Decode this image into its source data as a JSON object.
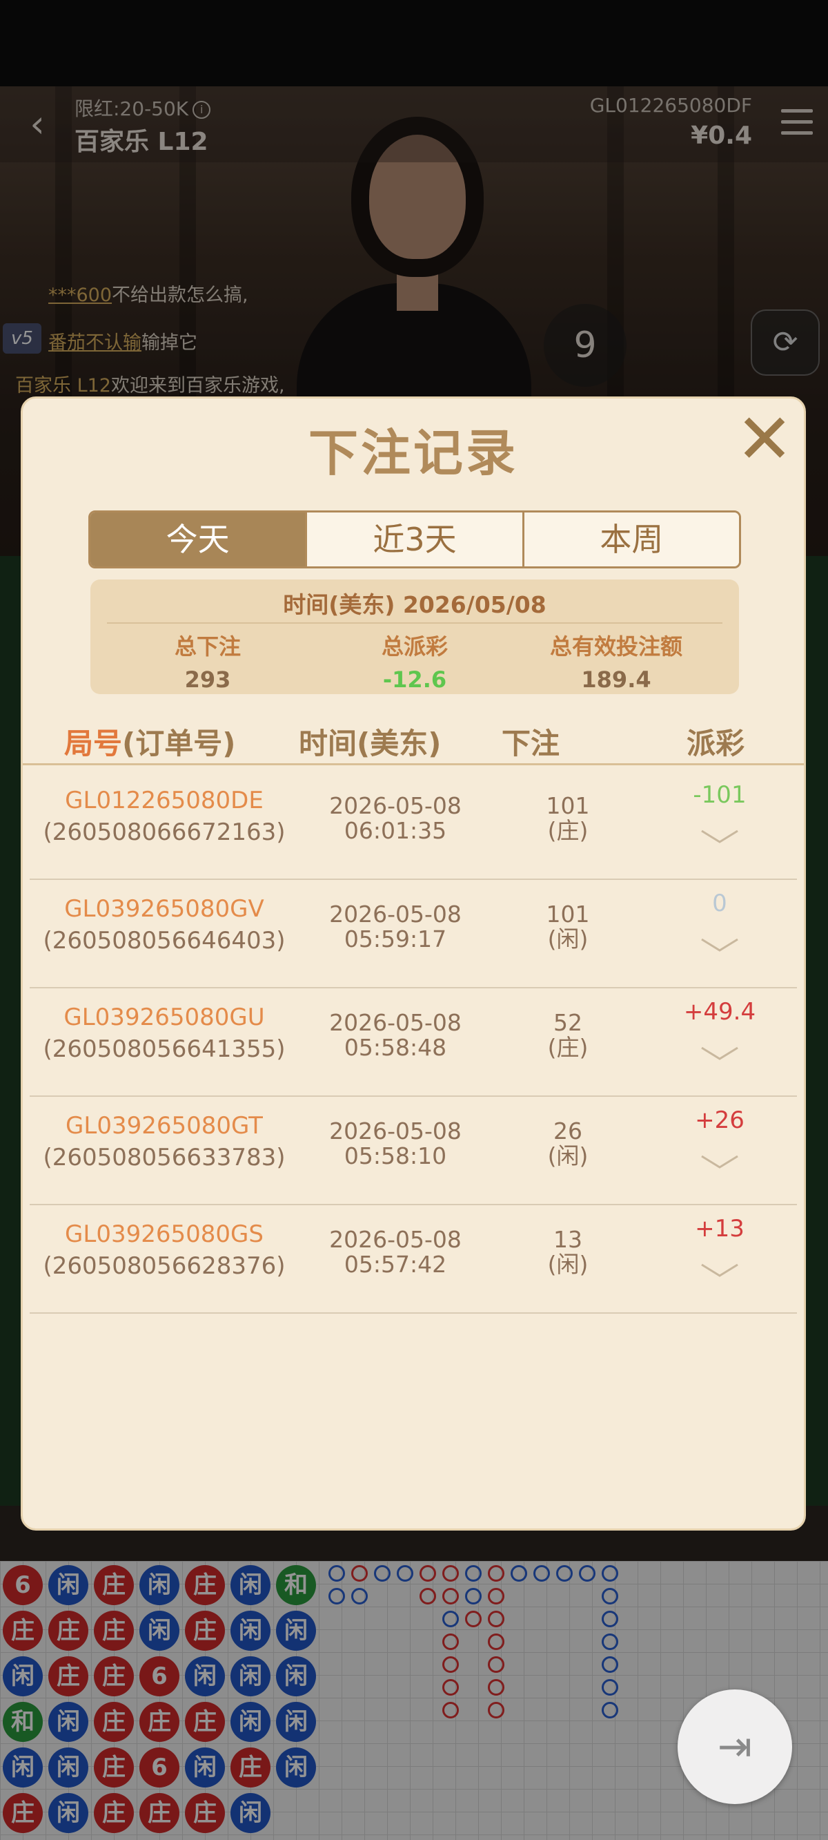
{
  "header": {
    "limit_label": "限红:20-50K",
    "table_name": "百家乐 L12",
    "account_id": "GL012265080DF",
    "balance": "¥0.4"
  },
  "chat": [
    {
      "user": "***600",
      "text": "不给出款怎么搞,"
    },
    {
      "user": "番茄不认输",
      "text": "输掉它"
    },
    {
      "user": "百家乐 L12",
      "text": "欢迎来到百家乐游戏,"
    }
  ],
  "round_number": "9",
  "modal": {
    "title": "下注记录",
    "tabs": [
      {
        "label": "今天",
        "active": true
      },
      {
        "label": "近3天",
        "active": false
      },
      {
        "label": "本周",
        "active": false
      }
    ],
    "summary": {
      "date_line": "时间(美东) 2026/05/08",
      "total_bet_label": "总下注",
      "total_bet": "293",
      "total_payout_label": "总派彩",
      "total_payout": "-12.6",
      "total_valid_label": "总有效投注额",
      "total_valid": "189.4"
    },
    "columns": {
      "round_highlight": "局号",
      "round_rest": "(订单号)",
      "time": "时间(美东)",
      "bet": "下注",
      "payout": "派彩"
    },
    "rows": [
      {
        "round": "GL012265080DE",
        "order": "(260508066672163)",
        "date": "2026-05-08",
        "time": "06:01:35",
        "bet": "101",
        "side": "(庄)",
        "payout": "-101",
        "tone": "neg"
      },
      {
        "round": "GL039265080GV",
        "order": "(260508056646403)",
        "date": "2026-05-08",
        "time": "05:59:17",
        "bet": "101",
        "side": "(闲)",
        "payout": "0",
        "tone": "zero"
      },
      {
        "round": "GL039265080GU",
        "order": "(260508056641355)",
        "date": "2026-05-08",
        "time": "05:58:48",
        "bet": "52",
        "side": "(庄)",
        "payout": "+49.4",
        "tone": "pos"
      },
      {
        "round": "GL039265080GT",
        "order": "(260508056633783)",
        "date": "2026-05-08",
        "time": "05:58:10",
        "bet": "26",
        "side": "(闲)",
        "payout": "+26",
        "tone": "pos"
      },
      {
        "round": "GL039265080GS",
        "order": "(260508056628376)",
        "date": "2026-05-08",
        "time": "05:57:42",
        "bet": "13",
        "side": "(闲)",
        "payout": "+13",
        "tone": "pos"
      }
    ]
  },
  "bead_road": [
    [
      "6",
      "闲",
      "庄",
      "闲",
      "庄",
      "闲",
      "和"
    ],
    [
      "庄",
      "庄",
      "庄",
      "闲",
      "庄",
      "闲",
      "闲"
    ],
    [
      "闲",
      "庄",
      "庄",
      "6",
      "闲",
      "闲",
      "闲"
    ],
    [
      "和",
      "闲",
      "庄",
      "庄",
      "庄",
      "闲",
      "闲"
    ],
    [
      "闲",
      "闲",
      "庄",
      "6",
      "闲",
      "庄",
      "闲"
    ],
    [
      "庄",
      "闲",
      "庄",
      "庄",
      "庄",
      "闲",
      ""
    ]
  ],
  "colors": {
    "modal_bg": "#f6ebd8",
    "accent_brown": "#a88657",
    "orange": "#e48b4a",
    "payout_negative": "#7ac85d",
    "payout_positive": "#d43d3d"
  },
  "icons": [
    "back-arrow-icon",
    "info-icon",
    "menu-icon",
    "camera-switch-icon",
    "close-icon",
    "chevron-down-icon",
    "exit-icon"
  ]
}
